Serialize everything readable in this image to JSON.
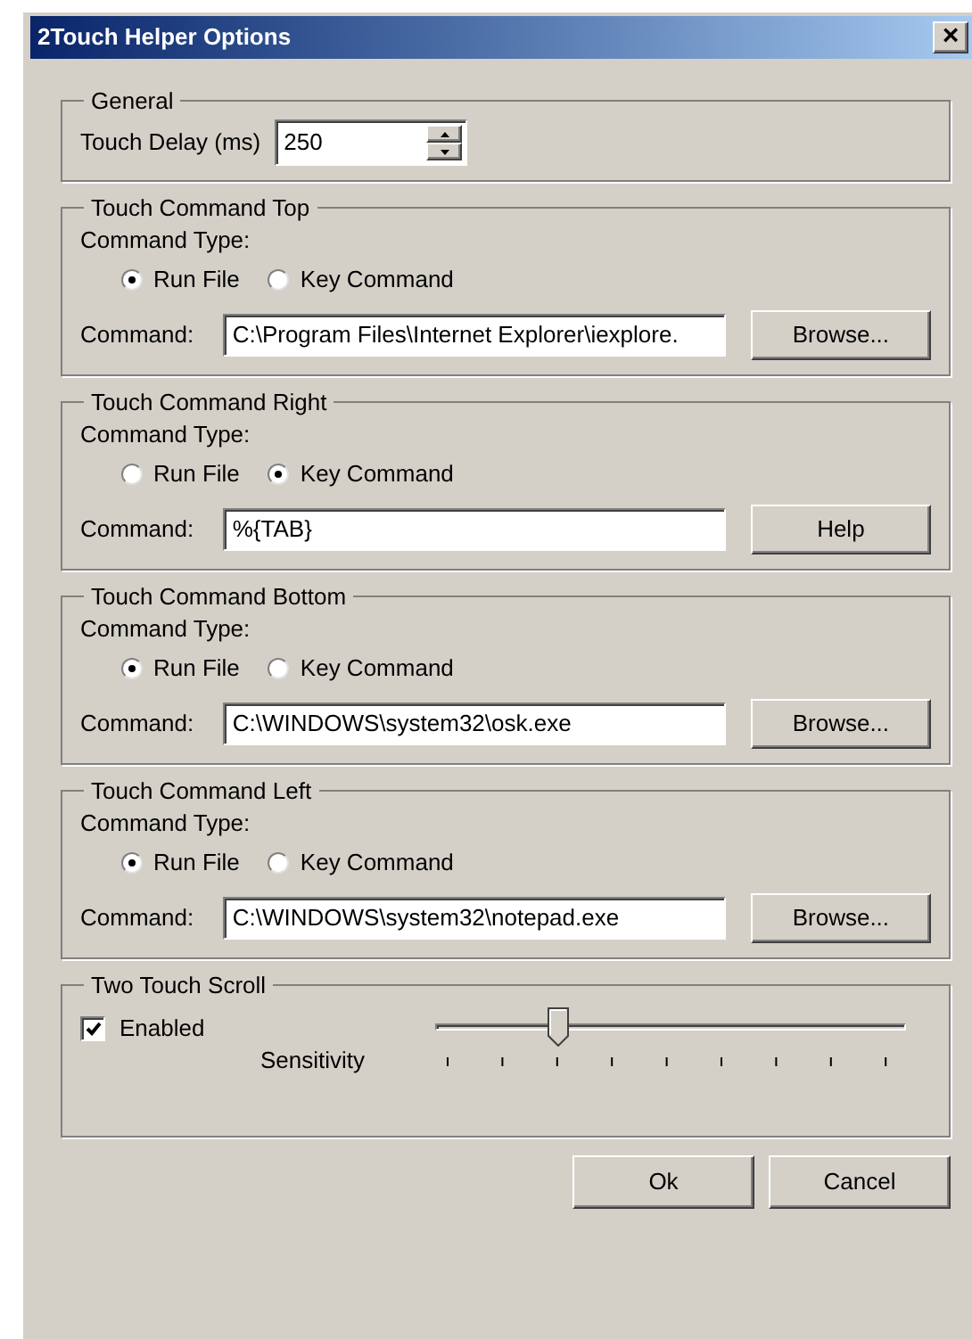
{
  "window": {
    "title": "2Touch Helper Options",
    "close": "×"
  },
  "general": {
    "title": "General",
    "label": "Touch Delay (ms)",
    "value": "250"
  },
  "commands": [
    {
      "title": "Touch Command Top",
      "type_label": "Command Type:",
      "options": [
        {
          "label": "Run File",
          "selected": true
        },
        {
          "label": "Key Command",
          "selected": false
        }
      ],
      "command_label": "Command:",
      "value": "C:\\Program Files\\Internet Explorer\\iexplore.",
      "button": "Browse..."
    },
    {
      "title": "Touch Command Right",
      "type_label": "Command Type:",
      "options": [
        {
          "label": "Run File",
          "selected": false
        },
        {
          "label": "Key Command",
          "selected": true
        }
      ],
      "command_label": "Command:",
      "value": "%{TAB}",
      "button": "Help"
    },
    {
      "title": "Touch Command Bottom",
      "type_label": "Command Type:",
      "options": [
        {
          "label": "Run File",
          "selected": true
        },
        {
          "label": "Key Command",
          "selected": false
        }
      ],
      "command_label": "Command:",
      "value": "C:\\WINDOWS\\system32\\osk.exe",
      "button": "Browse..."
    },
    {
      "title": "Touch Command Left",
      "type_label": "Command Type:",
      "options": [
        {
          "label": "Run File",
          "selected": true
        },
        {
          "label": "Key Command",
          "selected": false
        }
      ],
      "command_label": "Command:",
      "value": "C:\\WINDOWS\\system32\\notepad.exe",
      "button": "Browse..."
    }
  ],
  "scroll": {
    "title": "Two Touch Scroll",
    "enabled": {
      "label": "Enabled",
      "checked": true
    },
    "sensitivity": {
      "label": "Sensitivity",
      "level": 0.25
    }
  },
  "buttons": [
    "Ok",
    "Cancel"
  ]
}
